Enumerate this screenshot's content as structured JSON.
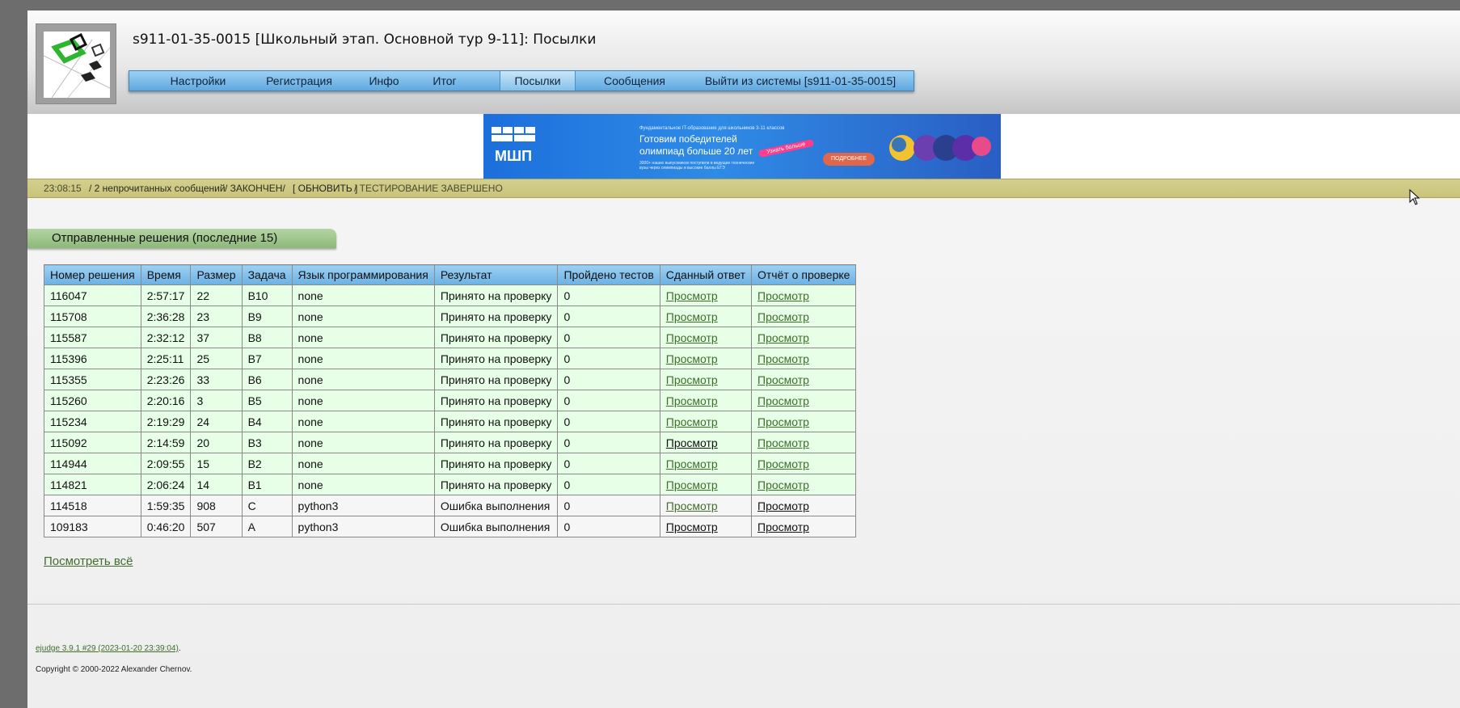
{
  "header": {
    "title": "s911-01-35-0015 [Школьный этап. Основной тур 9-11]: Посылки"
  },
  "menu": {
    "items": [
      {
        "label": "Настройки"
      },
      {
        "label": "Регистрация"
      },
      {
        "label": "Инфо"
      },
      {
        "label": "Итог"
      },
      {
        "label": "Посылки"
      },
      {
        "label": "Сообщения"
      },
      {
        "label": "Выйти из системы [s911-01-35-0015]"
      }
    ],
    "active": "Посылки"
  },
  "banner": {
    "logo_text": "МШП",
    "small_text": "Фундаментальное IT-образование для школьников 3-11 классов",
    "headline_1": "Готовим победителей",
    "headline_2": "олимпиад больше 20 лет",
    "pill": "Узнать больше",
    "button": "ПОДРОБНЕЕ",
    "footnote": "3000+ наших выпускников поступили в ведущие технические вузы через олимпиады и высокие баллы ЕГЭ"
  },
  "status": {
    "time": "23:08:15",
    "messages": "/ 2 непрочитанных сообщений",
    "state": "/ ЗАКОНЧЕН/",
    "refresh": "[ ОБНОВИТЬ ]",
    "testing": "/ ТЕСТИРОВАНИЕ ЗАВЕРШЕНО"
  },
  "section": {
    "title": "Отправленные решения (последние 15)"
  },
  "table": {
    "headers": [
      "Номер решения",
      "Время",
      "Размер",
      "Задача",
      "Язык программирования",
      "Результат",
      "Пройдено тестов",
      "Сданный ответ",
      "Отчёт о проверке"
    ],
    "rows": [
      [
        "116047",
        "2:57:17",
        "22",
        "B10",
        "none",
        "Принято на проверку",
        "0",
        "Просмотр",
        "Просмотр"
      ],
      [
        "115708",
        "2:36:28",
        "23",
        "B9",
        "none",
        "Принято на проверку",
        "0",
        "Просмотр",
        "Просмотр"
      ],
      [
        "115587",
        "2:32:12",
        "37",
        "B8",
        "none",
        "Принято на проверку",
        "0",
        "Просмотр",
        "Просмотр"
      ],
      [
        "115396",
        "2:25:11",
        "25",
        "B7",
        "none",
        "Принято на проверку",
        "0",
        "Просмотр",
        "Просмотр"
      ],
      [
        "115355",
        "2:23:26",
        "33",
        "B6",
        "none",
        "Принято на проверку",
        "0",
        "Просмотр",
        "Просмотр"
      ],
      [
        "115260",
        "2:20:16",
        "3",
        "B5",
        "none",
        "Принято на проверку",
        "0",
        "Просмотр",
        "Просмотр"
      ],
      [
        "115234",
        "2:19:29",
        "24",
        "B4",
        "none",
        "Принято на проверку",
        "0",
        "Просмотр",
        "Просмотр"
      ],
      [
        "115092",
        "2:14:59",
        "20",
        "B3",
        "none",
        "Принято на проверку",
        "0",
        "Просмотр",
        "Просмотр"
      ],
      [
        "114944",
        "2:09:55",
        "15",
        "B2",
        "none",
        "Принято на проверку",
        "0",
        "Просмотр",
        "Просмотр"
      ],
      [
        "114821",
        "2:06:24",
        "14",
        "B1",
        "none",
        "Принято на проверку",
        "0",
        "Просмотр",
        "Просмотр"
      ],
      [
        "114518",
        "1:59:35",
        "908",
        "C",
        "python3",
        "Ошибка выполнения",
        "0",
        "Просмотр",
        "Просмотр"
      ],
      [
        "109183",
        "0:46:20",
        "507",
        "A",
        "python3",
        "Ошибка выполнения",
        "0",
        "Просмотр",
        "Просмотр"
      ]
    ]
  },
  "view_all": "Посмотреть всё",
  "footer": {
    "version_link": "ejudge 3.9.1 #29 (2023-01-20 23:39:04)",
    "version_suffix": ".",
    "copyright": "Copyright © 2000-2022 Alexander Chernov."
  },
  "colors": {
    "accepted_row": "#e6ffe6",
    "error_row": "#f6f6f6",
    "menu_blue": "#5fa8df",
    "status_olive": "#c9c37a",
    "section_green": "#8cb878",
    "link_green": "#3f6e2b"
  }
}
